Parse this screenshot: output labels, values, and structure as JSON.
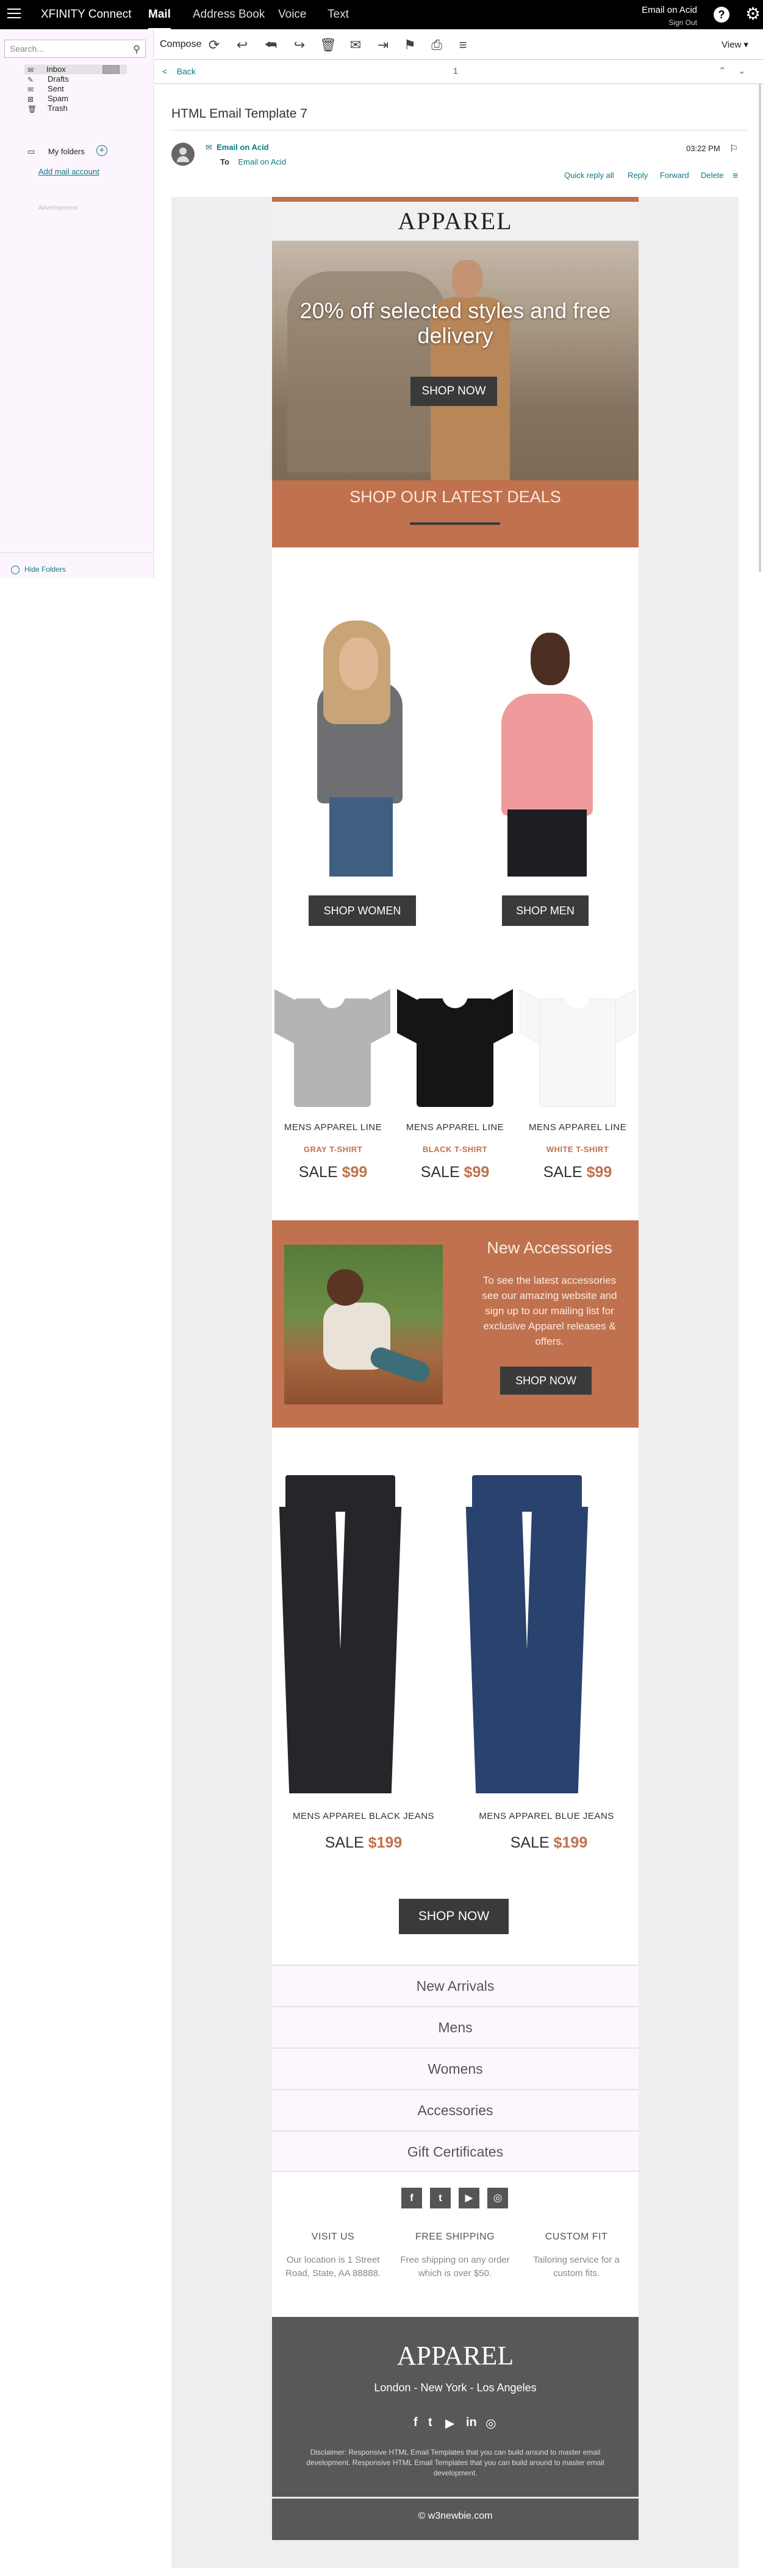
{
  "topbar": {
    "brand": "XFINITY Connect",
    "tabs": [
      "Mail",
      "Address Book",
      "Voice",
      "Text"
    ],
    "user": "Email on Acid",
    "signout": "Sign Out"
  },
  "sidebar": {
    "search_placeholder": "Search...",
    "folders": [
      {
        "label": "Inbox",
        "icon": "inbox-icon"
      },
      {
        "label": "Drafts",
        "icon": "drafts-icon"
      },
      {
        "label": "Sent",
        "icon": "sent-icon"
      },
      {
        "label": "Spam",
        "icon": "spam-icon"
      },
      {
        "label": "Trash",
        "icon": "trash-icon"
      }
    ],
    "my_folders": "My folders",
    "add_mail": "Add mail account",
    "advertisement": "Advertisement",
    "hide_folders": "Hide Folders"
  },
  "toolbar": {
    "compose": "Compose",
    "view": "View ▾"
  },
  "message": {
    "back": "Back",
    "page": "1",
    "subject": "HTML Email Template 7",
    "from": "Email on Acid",
    "to_label": "To",
    "to": "Email on Acid",
    "time": "03:22 PM",
    "actions": [
      "Quick reply all",
      "Reply",
      "Forward",
      "Delete"
    ]
  },
  "email": {
    "logo": "APPAREL",
    "hero_text": "20% off selected styles and free delivery",
    "hero_button": "SHOP NOW",
    "deals": "SHOP OUR LATEST DEALS",
    "shop_women": "SHOP WOMEN",
    "shop_men": "SHOP MEN",
    "shirts": [
      {
        "line": "MENS APPAREL LINE",
        "name": "GRAY T-SHIRT",
        "sale": "SALE",
        "price": "$99",
        "color": "#b4b4b4"
      },
      {
        "line": "MENS APPAREL LINE",
        "name": "BLACK T-SHIRT",
        "sale": "SALE",
        "price": "$99",
        "color": "#151515"
      },
      {
        "line": "MENS APPAREL LINE",
        "name": "WHITE T-SHIRT",
        "sale": "SALE",
        "price": "$99",
        "color": "#f7f7f9"
      }
    ],
    "accessories": {
      "title": "New Accessories",
      "text": "To see the latest accessories see our amazing website and sign up to our mailing list for exclusive Apparel releases & offers.",
      "button": "SHOP NOW"
    },
    "jeans": [
      {
        "name": "MENS APPAREL BLACK JEANS",
        "sale": "SALE",
        "price": "$199",
        "color": "#26262a"
      },
      {
        "name": "MENS APPAREL BLUE JEANS",
        "sale": "SALE",
        "price": "$199",
        "color": "#29426e"
      }
    ],
    "jeans_button": "SHOP NOW",
    "menu": [
      "New Arrivals",
      "Mens",
      "Womens",
      "Accessories",
      "Gift Certificates"
    ],
    "social": [
      "f",
      "t",
      "▶",
      "◎"
    ],
    "info": [
      {
        "title": "VISIT US",
        "text": "Our location is 1 Street Road, State, AA 88888."
      },
      {
        "title": "FREE SHIPPING",
        "text": "Free shipping on any order which is over $50."
      },
      {
        "title": "CUSTOM FIT",
        "text": "Tailoring service for a custom fits."
      }
    ],
    "footer": {
      "logo": "APPAREL",
      "cities": "London - New York - Los Angeles",
      "social": [
        "f",
        "t",
        "▶",
        "in",
        "◎"
      ],
      "disclaimer": "Disclaimer: Responsive HTML Email Templates that you can build around to master email development. Responsive HTML Email Templates that you can build around to master email development.",
      "copyright": "© w3newbie.com"
    }
  },
  "colors": {
    "accent": "#c0714d",
    "dark": "#3a3a3a",
    "link": "#0c7a85"
  }
}
